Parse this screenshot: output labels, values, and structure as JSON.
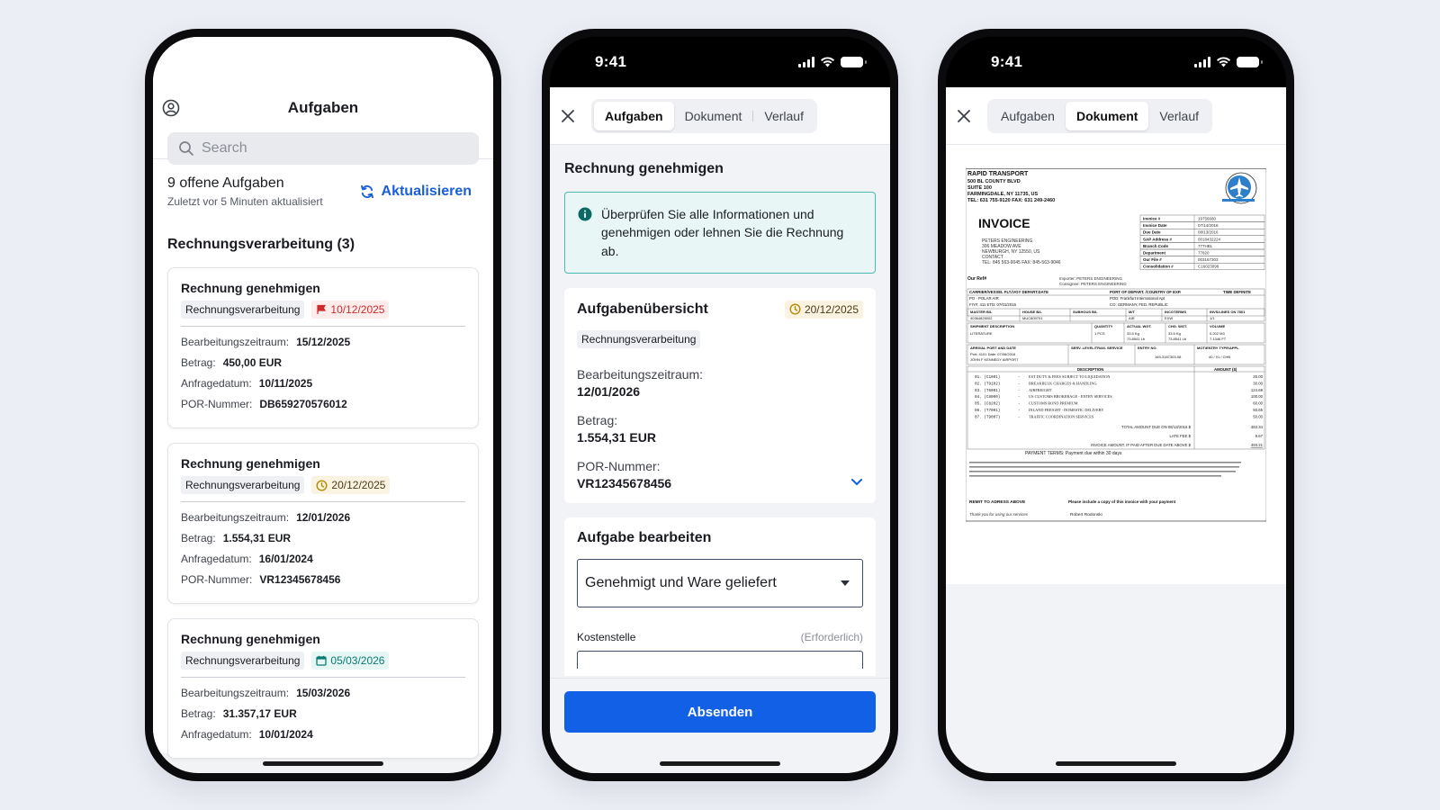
{
  "status_time": "9:41",
  "phone1": {
    "title": "Aufgaben",
    "search_placeholder": "Search",
    "open_count": "9 offene Aufgaben",
    "updated_text": "Zuletzt vor 5 Minuten aktualisiert",
    "refresh_label": "Aktualisieren",
    "section_title": "Rechnungsverarbeitung (3)",
    "cards": [
      {
        "title": "Rechnung genehmigen",
        "category": "Rechnungsverarbeitung",
        "date": "10/12/2025",
        "date_icon": "flag-icon",
        "date_color": "#cf2a2a",
        "labels": [
          "Bearbeitungszeitraum:",
          "Betrag:",
          "Anfragedatum:",
          "POR-Nummer:"
        ],
        "values": [
          "15/12/2025",
          "450,00 EUR",
          "10/11/2025",
          "DB659270576012"
        ]
      },
      {
        "title": "Rechnung genehmigen",
        "category": "Rechnungsverarbeitung",
        "date": "20/12/2025",
        "date_icon": "clock-icon",
        "date_color": "#b58a00",
        "labels": [
          "Bearbeitungszeitraum:",
          "Betrag:",
          "Anfragedatum:",
          "POR-Nummer:"
        ],
        "values": [
          "12/01/2026",
          "1.554,31 EUR",
          "16/01/2024",
          "VR12345678456"
        ]
      },
      {
        "title": "Rechnung genehmigen",
        "category": "Rechnungsverarbeitung",
        "date": "05/03/2026",
        "date_icon": "calendar-icon",
        "date_color": "#0b7a74",
        "labels": [
          "Bearbeitungszeitraum:",
          "Betrag:",
          "Anfragedatum:"
        ],
        "values": [
          "15/03/2026",
          "31.357,17 EUR",
          "10/01/2024"
        ]
      }
    ]
  },
  "phone2": {
    "tabs": [
      "Aufgaben",
      "Dokument",
      "Verlauf"
    ],
    "active_tab": "Aufgaben",
    "heading": "Rechnung genehmigen",
    "info_text": "Überprüfen Sie alle Informationen und genehmigen oder lehnen Sie die Rechnung ab.",
    "overview": {
      "title": "Aufgabenübersicht",
      "date": "20/12/2025",
      "category": "Rechnungsverarbeitung",
      "fields": [
        {
          "label": "Bearbeitungszeitraum:",
          "value": "12/01/2026"
        },
        {
          "label": "Betrag:",
          "value": "1.554,31 EUR"
        },
        {
          "label": "POR-Nummer:",
          "value": "VR12345678456"
        }
      ]
    },
    "edit": {
      "title": "Aufgabe bearbeiten",
      "select_value": "Genehmigt und Ware geliefert",
      "cost_center_label": "Kostenstelle",
      "required_text": "(Erforderlich)"
    },
    "submit_label": "Absenden"
  },
  "phone3": {
    "tabs": [
      "Aufgaben",
      "Dokument",
      "Verlauf"
    ],
    "active_tab": "Dokument",
    "invoice": {
      "company": "RAPID TRANSPORT",
      "address": [
        "500 BL COUNTY BLVD",
        "SUITE 100",
        "FARMINGDALE, NY 11735, US",
        "TEL: 631 755-9120 FAX: 631 249-2460"
      ],
      "heading": "INVOICE",
      "bill_to": [
        "PETERS ENGINEERING",
        "306 MEADOW AVE",
        "NEWBURGH, NY 12550, US",
        "CONTACT",
        "TEL: 845 563-9045  FAX: 845-563-9046"
      ],
      "meta_labels": [
        "Invoice #",
        "Invoice Date",
        "Due Date",
        "SAP Address #",
        "Branch Code",
        "Department",
        "Our File #",
        "Consolidation #"
      ],
      "meta_values": [
        "19756680",
        "07/14/2016",
        "08/13/2016",
        "0018432224",
        "777HBL",
        "77820",
        "003167303",
        "C16023099"
      ],
      "our_ref": "Our Ref#",
      "importer": "Importer: PETERS ENGINEERING",
      "consignee": "Consignee: PETERS ENGINEERING",
      "ship_headers": [
        "CARRIER/VESSEL FLT./VOY DEPART.DATE",
        "PORT OF DEPART. /COUNTRY OF EXP.",
        "TIME DEFINITE"
      ],
      "ship_values": [
        "PO - POLAR AIR",
        "POD: Frankfurt International Apt",
        "FIY#: 411   ETD: 07/01/2016",
        "CO: GERMANY, FED. REPUBLIC"
      ],
      "bl_headers": [
        "MASTER B/L",
        "HOUSE B/L",
        "SUBHOUS B/L",
        "M/T",
        "INCOTERMS",
        "INVS/LINES ON 7501"
      ],
      "bl_values": [
        "40364825002",
        "MUC809701",
        "",
        "AIR",
        "EXW",
        "1/1"
      ],
      "desc_headers": [
        "SHIPMENT DESCRIPTION",
        "QUANTITY",
        "ACTUAL WGT.",
        "CHG. WGT.",
        "VOLUME"
      ],
      "desc_values": [
        "LITERATURE",
        "1 PCS",
        "33.5 Kg",
        "33.5 Kg",
        "0.202 M3"
      ],
      "desc_values2": [
        "",
        "",
        "73.8541 Lb",
        "73.8541 Lb",
        "7.1346 FT"
      ],
      "arrival_headers": [
        "ARRIVAL PORT AND DATE",
        "SERV. LEVEL/TRAN. SERVICE",
        "ENTRY NO.",
        "MOT/ENTRY TYPE/APPL"
      ],
      "arrival_values": [
        "Port: 4101   Date: 07/06/2016",
        "JOHN F KENNEDY AIRPORT",
        "169-3167303-08",
        "40 / 01 / CHB"
      ],
      "charges_headers": [
        "DESCRIPTION",
        "AMOUNT ($)"
      ],
      "charges": [
        {
          "code": "01.  (C1001)",
          "desc": "EST DUTY & FEES SUBJECT TO LIQUIDATION",
          "amount": "25.00"
        },
        {
          "code": "02.  (T9102)",
          "desc": "BREAKBULK CHARGES & HANDLING",
          "amount": "30.00"
        },
        {
          "code": "03.  (T6001)",
          "desc": "AIRFREIGHT",
          "amount": "124.69"
        },
        {
          "code": "04.  (C8000)",
          "desc": "US CUSTOMS BROKERAGE - ENTRY SERVICES",
          "amount": "100.00"
        },
        {
          "code": "05.  (C8202)",
          "desc": "CUSTOMS BOND PREMIUM",
          "amount": "60.00"
        },
        {
          "code": "06.  (T7001)",
          "desc": "INLAND FREIGHT - DOMESTIC DELIVERY",
          "amount": "93.65"
        },
        {
          "code": "07.  (T9007)",
          "desc": "TRAFFIC COORDINATION SERVICES",
          "amount": "50.00"
        }
      ],
      "total_label": "TOTAL AMOUNT DUE ON 08/13/2016 $",
      "total_value": "483.34",
      "late_fee_label": "LATE FEE $",
      "late_fee_value": "9.67",
      "late_total_label": "INVOICE AMOUNT, IF PAID AFTER DUE DATE ABOVE $",
      "late_total_value": "493.21",
      "payment_terms": "PAYMENT TERMS: Payment due within 30 days",
      "remit": "REMIT TO ADRESS ABOVE",
      "thanks": "Thank you for using our services",
      "copy_note": "Please include a copy of this invoice with your payment",
      "signer": "Robert Rodonski"
    }
  },
  "colors": {
    "accent": "#1160e6",
    "link": "#1a5fd6",
    "info_border": "#4bbab3",
    "info_bg": "#e8f7f6"
  }
}
